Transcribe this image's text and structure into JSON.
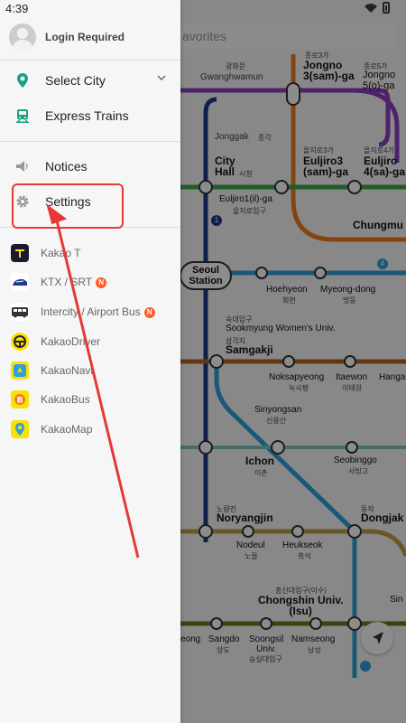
{
  "status": {
    "time": "4:39"
  },
  "map": {
    "search_placeholder": "avorites",
    "labels": {
      "jongno3": "Jongno\n3(sam)-ga",
      "jongno5": "Jongno\n5(o)-ga",
      "gwanghwamun_kr": "광화문",
      "gwanghwamun": "Gwanghwamun",
      "jongno3_kr": "종로3가",
      "jongno5_kr": "종로5가",
      "jonggak": "Jonggak",
      "jonggak_kr": "종각",
      "cityhall": "City\nHall",
      "cityhall_kr": "시청",
      "euljiro3": "Euljiro3\n(sam)-ga",
      "euljiro3_kr": "을지로3가",
      "euljiro4": "Euljiro\n4(sa)-ga",
      "euljiro4_kr": "을지로4가",
      "euljiro1": "Euljiro1(il)-ga",
      "euljiro1_kr": "을지로입구",
      "chungmu": "Chungmu",
      "seoulstation": "Seoul\nStation",
      "hoehyeon": "Hoehyeon",
      "hoehyeon_kr": "회현",
      "myeongdong": "Myeong-dong",
      "myeongdong_kr": "명동",
      "sookmyung_kr": "숙대입구",
      "sookmyung": "Sookmyung Women's Univ.",
      "samgakji_kr": "삼각지",
      "samgakji": "Samgakji",
      "noksapyeong": "Noksapyeong",
      "noksapyeong_kr": "녹사평",
      "itaewon": "Itaewon",
      "itaewon_kr": "이태원",
      "hanga": "Hanga",
      "sinyongsan": "Sinyongsan",
      "sinyongsan_kr": "신용산",
      "ichon": "Ichon",
      "ichon_kr": "이촌",
      "seobinggo": "Seobinggo",
      "seobinggo_kr": "서빙고",
      "noryangjin_kr": "노량진",
      "noryangjin": "Noryangjin",
      "dongjak_kr": "동작",
      "dongjak": "Dongjak",
      "nodeul": "Nodeul",
      "nodeul_kr": "노들",
      "heukseok": "Heukseok",
      "heukseok_kr": "흑석",
      "chongshin_kr": "총신대입구(이수)",
      "chongshin": "Chongshin Univ.\n(Isu)",
      "sangdo": "Sangdo",
      "sangdo_kr": "상도",
      "soongsil": "Soongsil\nUniv.",
      "soongsil_kr": "숭실대입구",
      "namseong": "Namseong",
      "namseong_kr": "남성",
      "eong": "eong",
      "sin": "Sin",
      "line_1": "1",
      "line_4": "4"
    }
  },
  "drawer": {
    "login_label": "Login Required",
    "menu": [
      {
        "label": "Select City",
        "icon": "location-pin-icon"
      },
      {
        "label": "Express Trains",
        "icon": "train-icon"
      },
      {
        "label": "Notices",
        "icon": "speaker-icon"
      },
      {
        "label": "Settings",
        "icon": "gear-icon"
      }
    ],
    "apps": [
      {
        "label": "Kakao T",
        "badge": ""
      },
      {
        "label": "KTX / SRT",
        "badge": "N"
      },
      {
        "label": "Intercity / Airport Bus",
        "badge": "N"
      },
      {
        "label": "KakaoDriver",
        "badge": ""
      },
      {
        "label": "KakaoNavi",
        "badge": ""
      },
      {
        "label": "KakaoBus",
        "badge": ""
      },
      {
        "label": "KakaoMap",
        "badge": ""
      }
    ]
  },
  "colors": {
    "accent_green": "#1aa086",
    "highlight_red": "#e53935",
    "kakao_yellow": "#fae100",
    "line1_blue": "#1d3a8f",
    "line2_green": "#3ba84a",
    "line3_orange": "#ef7c1c",
    "line4_cyan": "#2ca0dc",
    "line5_purple": "#8b3fc6",
    "line6_brown": "#b5651d",
    "line9_gold": "#bfa040"
  }
}
